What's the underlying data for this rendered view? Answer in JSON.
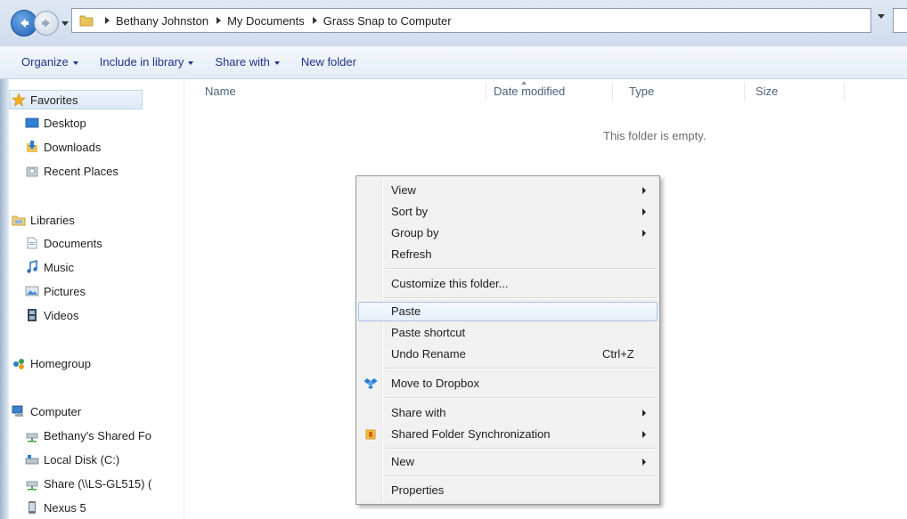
{
  "address_bar": {
    "crumbs": [
      "Bethany Johnston",
      "My Documents",
      "Grass Snap to Computer"
    ]
  },
  "toolbar": {
    "organize": "Organize",
    "include_in_library": "Include in library",
    "share_with": "Share with",
    "new_folder": "New folder"
  },
  "sidebar": {
    "favorites": "Favorites",
    "desktop": "Desktop",
    "downloads": "Downloads",
    "recent_places": "Recent Places",
    "libraries": "Libraries",
    "documents": "Documents",
    "music": "Music",
    "pictures": "Pictures",
    "videos": "Videos",
    "homegroup": "Homegroup",
    "computer": "Computer",
    "shared_folder": "Bethany's Shared Fo",
    "local_disk": "Local Disk (C:)",
    "share": "Share (\\\\LS-GL515) (",
    "nexus": "Nexus 5"
  },
  "columns": {
    "name": "Name",
    "date_modified": "Date modified",
    "type": "Type",
    "size": "Size"
  },
  "empty_message": "This folder is empty.",
  "context_menu": {
    "view": "View",
    "sort_by": "Sort by",
    "group_by": "Group by",
    "refresh": "Refresh",
    "customize": "Customize this folder...",
    "paste": "Paste",
    "paste_shortcut": "Paste shortcut",
    "undo_rename": "Undo Rename",
    "undo_shortcut": "Ctrl+Z",
    "move_to_dropbox": "Move to Dropbox",
    "share_with": "Share with",
    "shared_folder_sync": "Shared Folder Synchronization",
    "new": "New",
    "properties": "Properties"
  },
  "colors": {
    "accent": "#1e3287",
    "highlight": "#a8c4e5"
  }
}
